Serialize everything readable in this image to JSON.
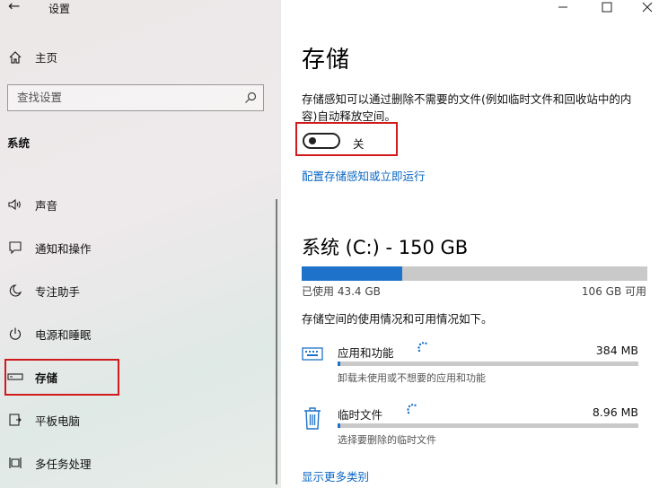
{
  "window": {
    "title": "设置"
  },
  "sidebar": {
    "home": "主页",
    "search_placeholder": "查找设置",
    "section": "系统",
    "items": [
      {
        "label": "声音",
        "icon": "speaker-icon"
      },
      {
        "label": "通知和操作",
        "icon": "notification-icon"
      },
      {
        "label": "专注助手",
        "icon": "moon-icon"
      },
      {
        "label": "电源和睡眠",
        "icon": "power-icon"
      },
      {
        "label": "存储",
        "icon": "storage-icon",
        "selected": true
      },
      {
        "label": "平板电脑",
        "icon": "tablet-icon"
      },
      {
        "label": "多任务处理",
        "icon": "multitask-icon"
      }
    ]
  },
  "main": {
    "title": "存储",
    "description": "存储感知可以通过删除不需要的文件(例如临时文件和回收站中的内容)自动释放空间。",
    "toggle": {
      "state": "关",
      "on": false
    },
    "configure_link": "配置存储感知或立即运行",
    "drive": {
      "title": "系统 (C:) - 150 GB",
      "used": "已使用 43.4 GB",
      "free": "106 GB 可用",
      "used_fraction": 0.29
    },
    "usage_note": "存储空间的使用情况和可用情况如下。",
    "categories": [
      {
        "name": "应用和功能",
        "size": "384 MB",
        "sub": "卸载未使用或不想要的应用和功能",
        "icon": "keyboard-icon",
        "fraction": 0.01
      },
      {
        "name": "临时文件",
        "size": "8.96 MB",
        "sub": "选择要删除的临时文件",
        "icon": "trash-icon",
        "fraction": 0.005
      }
    ],
    "more_link": "显示更多类别"
  },
  "colors": {
    "accent": "#1f72c9",
    "highlight_box": "#d11a1a",
    "link": "#0b67c3"
  }
}
